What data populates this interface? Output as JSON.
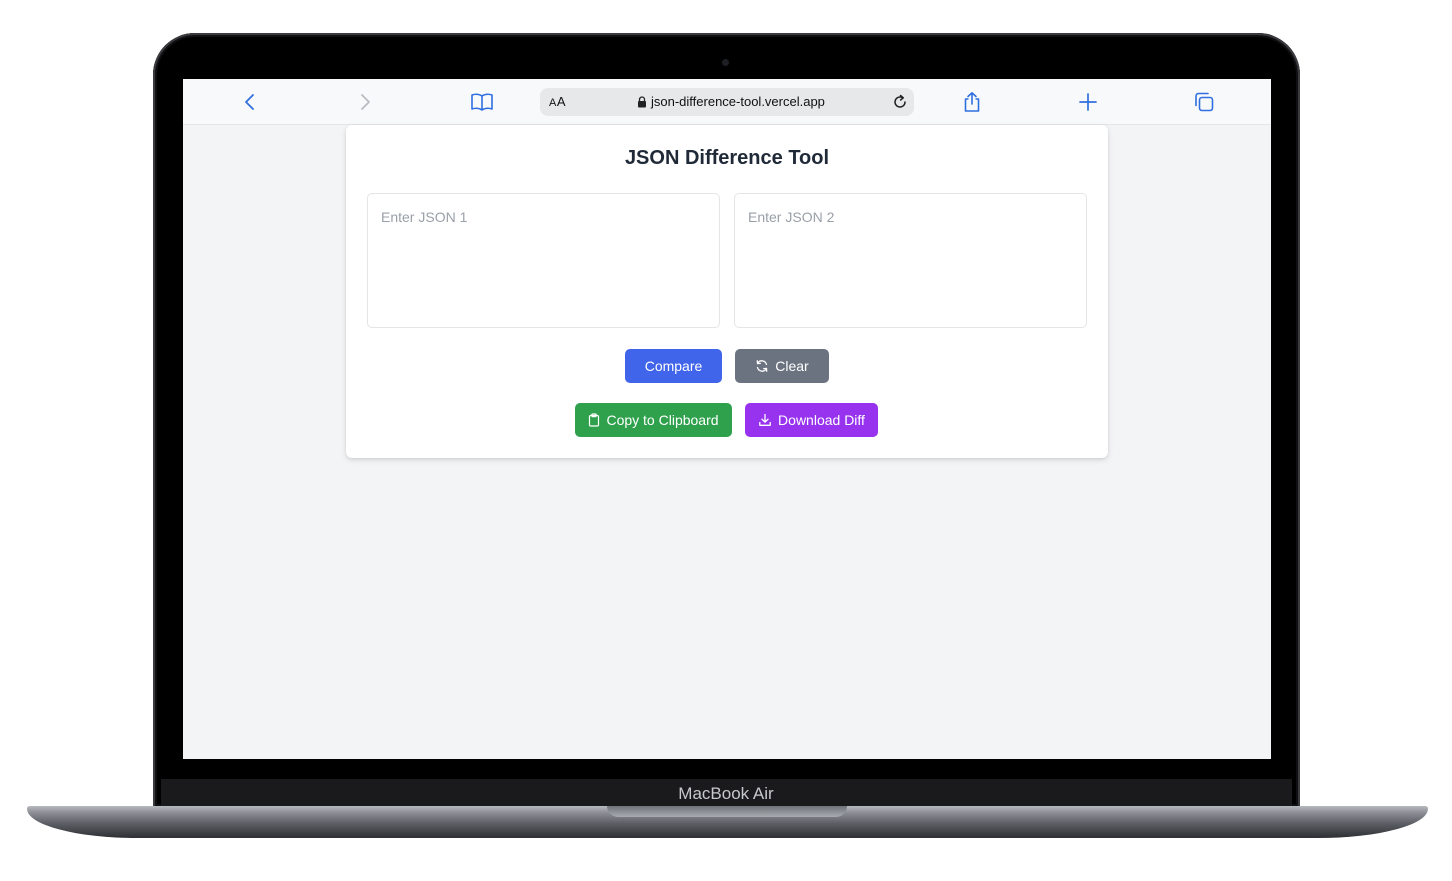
{
  "device": {
    "label": "MacBook Air"
  },
  "browser": {
    "text_size_label_small": "A",
    "text_size_label_large": "A",
    "url": "json-difference-tool.vercel.app",
    "icons": {
      "back": "chevron-left-icon",
      "forward": "chevron-right-icon",
      "bookmarks": "book-icon",
      "lock": "lock-icon",
      "reload": "reload-icon",
      "share": "share-icon",
      "new_tab": "plus-icon",
      "tabs": "tabs-icon"
    },
    "accent_color": "#2f6fe0"
  },
  "app": {
    "title": "JSON Difference Tool",
    "inputs": {
      "json1": {
        "value": "",
        "placeholder": "Enter JSON 1"
      },
      "json2": {
        "value": "",
        "placeholder": "Enter JSON 2"
      }
    },
    "buttons": {
      "compare": {
        "label": "Compare",
        "color": "#4064ea"
      },
      "clear": {
        "label": "Clear",
        "icon": "refresh-icon",
        "color": "#6b7280"
      },
      "copy": {
        "label": "Copy to Clipboard",
        "icon": "clipboard-icon",
        "color": "#2fa14d"
      },
      "download": {
        "label": "Download Diff",
        "icon": "download-icon",
        "color": "#9733ee"
      }
    }
  }
}
